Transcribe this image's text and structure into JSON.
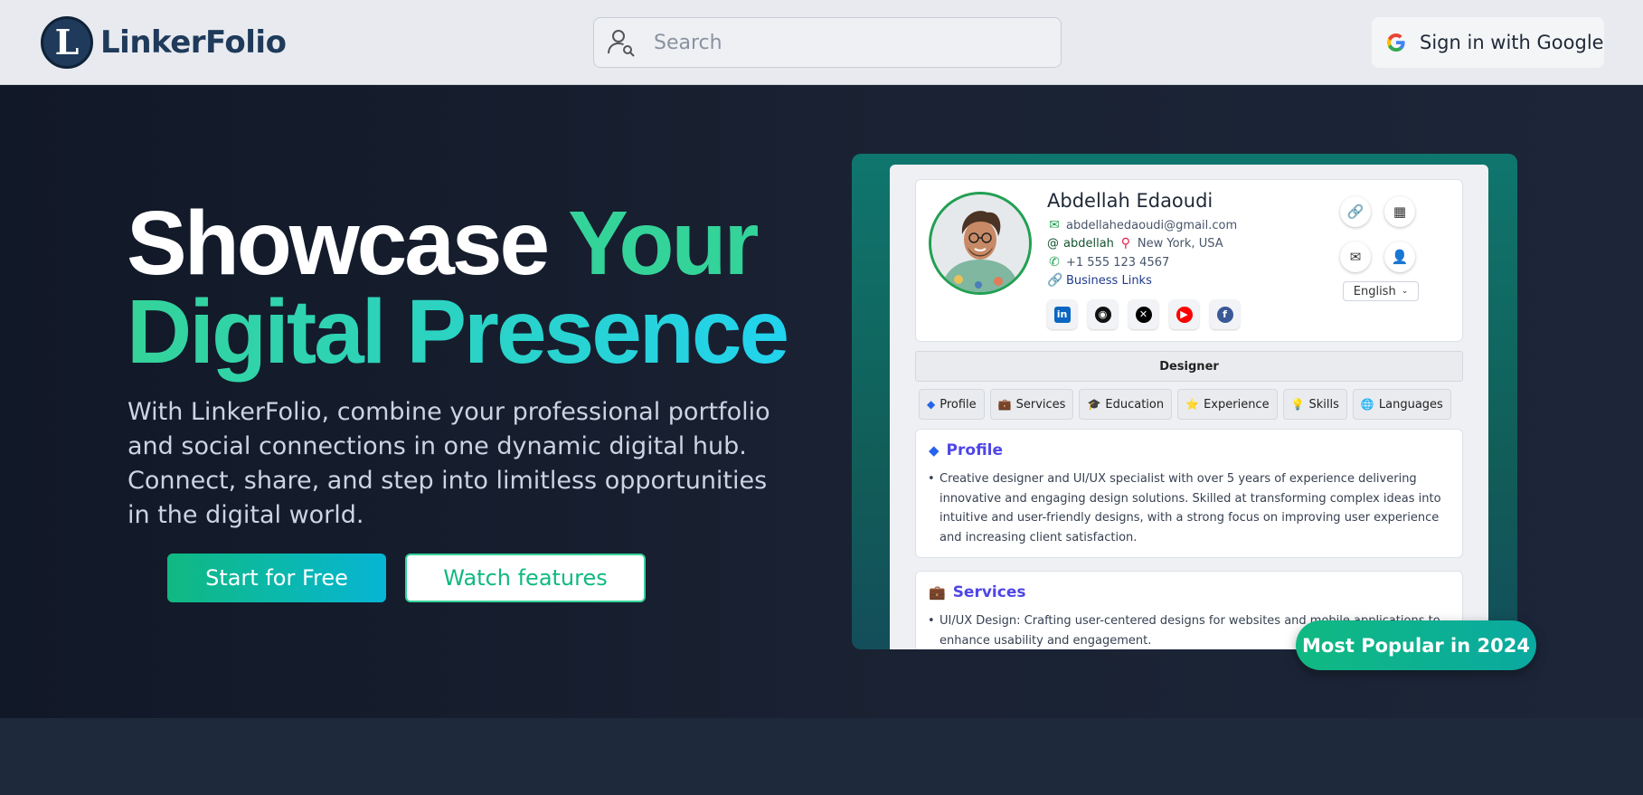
{
  "header": {
    "logo_letter": "L",
    "logo_text": "LinkerFolio",
    "search_placeholder": "Search",
    "signin_label": "Sign in with Google"
  },
  "hero": {
    "title_part1": "Showcase ",
    "title_part2": "Your",
    "title_line2": "Digital Presence",
    "subtitle": "With LinkerFolio, combine your professional portfolio and social connections in one dynamic digital hub. Connect, share, and step into limitless opportunities in the digital world.",
    "start_label": "Start for Free",
    "watch_label": "Watch features"
  },
  "preview": {
    "name": "Abdellah Edaoudi",
    "email": "abdellahedaoudi@gmail.com",
    "handle": "abdellah",
    "location": "New York, USA",
    "phone": "+1 555 123 4567",
    "business_links": "Business Links",
    "language": "English",
    "role": "Designer",
    "tabs": [
      {
        "icon": "◆",
        "label": "Profile"
      },
      {
        "icon": "💼",
        "label": "Services"
      },
      {
        "icon": "🎓",
        "label": "Education"
      },
      {
        "icon": "⭐",
        "label": "Experience"
      },
      {
        "icon": "💡",
        "label": "Skills"
      },
      {
        "icon": "🌐",
        "label": "Languages"
      }
    ],
    "profile_title": "Profile",
    "profile_text": "Creative designer and UI/UX specialist with over 5 years of experience delivering innovative and engaging design solutions. Skilled at transforming complex ideas into intuitive and user-friendly designs, with a strong focus on improving user experience and increasing client satisfaction.",
    "services_title": "Services",
    "services_text": "UI/UX Design: Crafting user-centered designs for websites and mobile applications to enhance usability and engagement."
  },
  "badge": "Most Popular in 2024",
  "colors": {
    "accent_green": "#10b981",
    "accent_cyan": "#22d3ee",
    "brand_navy": "#1f3a5a",
    "section_title": "#4f46e5"
  }
}
